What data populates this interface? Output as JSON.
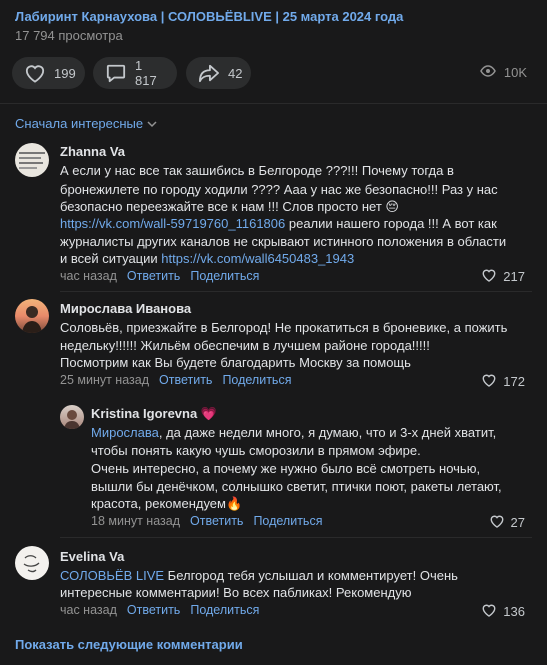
{
  "post": {
    "title": "Лабиринт Карнаухова | СОЛОВЬЁВLIVE | 25 марта 2024 года",
    "views_text": "17 794 просмотра"
  },
  "actions": {
    "likes": "199",
    "comments": "1 817",
    "shares": "42",
    "views": "10K"
  },
  "sort_label": "Сначала интересные",
  "comments": [
    {
      "name": "Zhanna Va",
      "lines": [
        "А если у нас все так зашибись в Белгороде ???!!! Почему тогда в",
        "бронежилете по городу ходили ???? Ааа у нас же безопасно!!! Раз у нас",
        "безопасно переезжайте все к нам !!! Слов просто нет 😔"
      ],
      "link1": "https://vk.com/wall-59719760_1161806",
      "line4_rest": " реалии нашего города !!! А вот как",
      "line5": "журналисты других каналов не скрывают истинного положения в области",
      "line6_start": "и всей ситуации ",
      "link2": "https://vk.com/wall6450483_1943",
      "time": "час назад",
      "reply": "Ответить",
      "share": "Поделиться",
      "likes": "217"
    },
    {
      "name": "Мирослава Иванова",
      "lines": [
        "Соловьёв, приезжайте в Белгород! Не прокатиться в броневике, а пожить",
        "недельку!!!!!! Жильём обеспечим в лучшем районе города!!!!!",
        "Посмотрим как Вы будете благодарить Москву за помощь"
      ],
      "time": "25 минут назад",
      "reply": "Ответить",
      "share": "Поделиться",
      "likes": "172"
    },
    {
      "name": "Kristina Igorevna",
      "name_emoji": "💗",
      "mention": "Мирослава",
      "line1_rest": ", да даже недели много, я думаю, что и 3-х дней хватит,",
      "lines": [
        "чтобы понять какую чушь сморозили в прямом эфире.",
        "Очень интересно, а почему же нужно было всё смотреть ночью,",
        "вышли бы денёчком, солнышко светит, птички поют, ракеты летают,",
        "красота, рекомендуем🔥"
      ],
      "time": "18 минут назад",
      "reply": "Ответить",
      "share": "Поделиться",
      "likes": "27"
    },
    {
      "name": "Evelina Va",
      "mention": "СОЛОВЬЁВ LIVE",
      "line1_rest": " Белгород тебя услышал и комментирует! Очень",
      "lines": [
        "интересные комментарии! Во всех пабликах! Рекомендую"
      ],
      "time": "час назад",
      "reply": "Ответить",
      "share": "Поделиться",
      "likes": "136"
    }
  ],
  "show_more": "Показать следующие комментарии",
  "colors": {
    "background": "#19191a",
    "accent": "#71aaeb",
    "button": "#2c2d2e",
    "secondary": "#939393"
  }
}
